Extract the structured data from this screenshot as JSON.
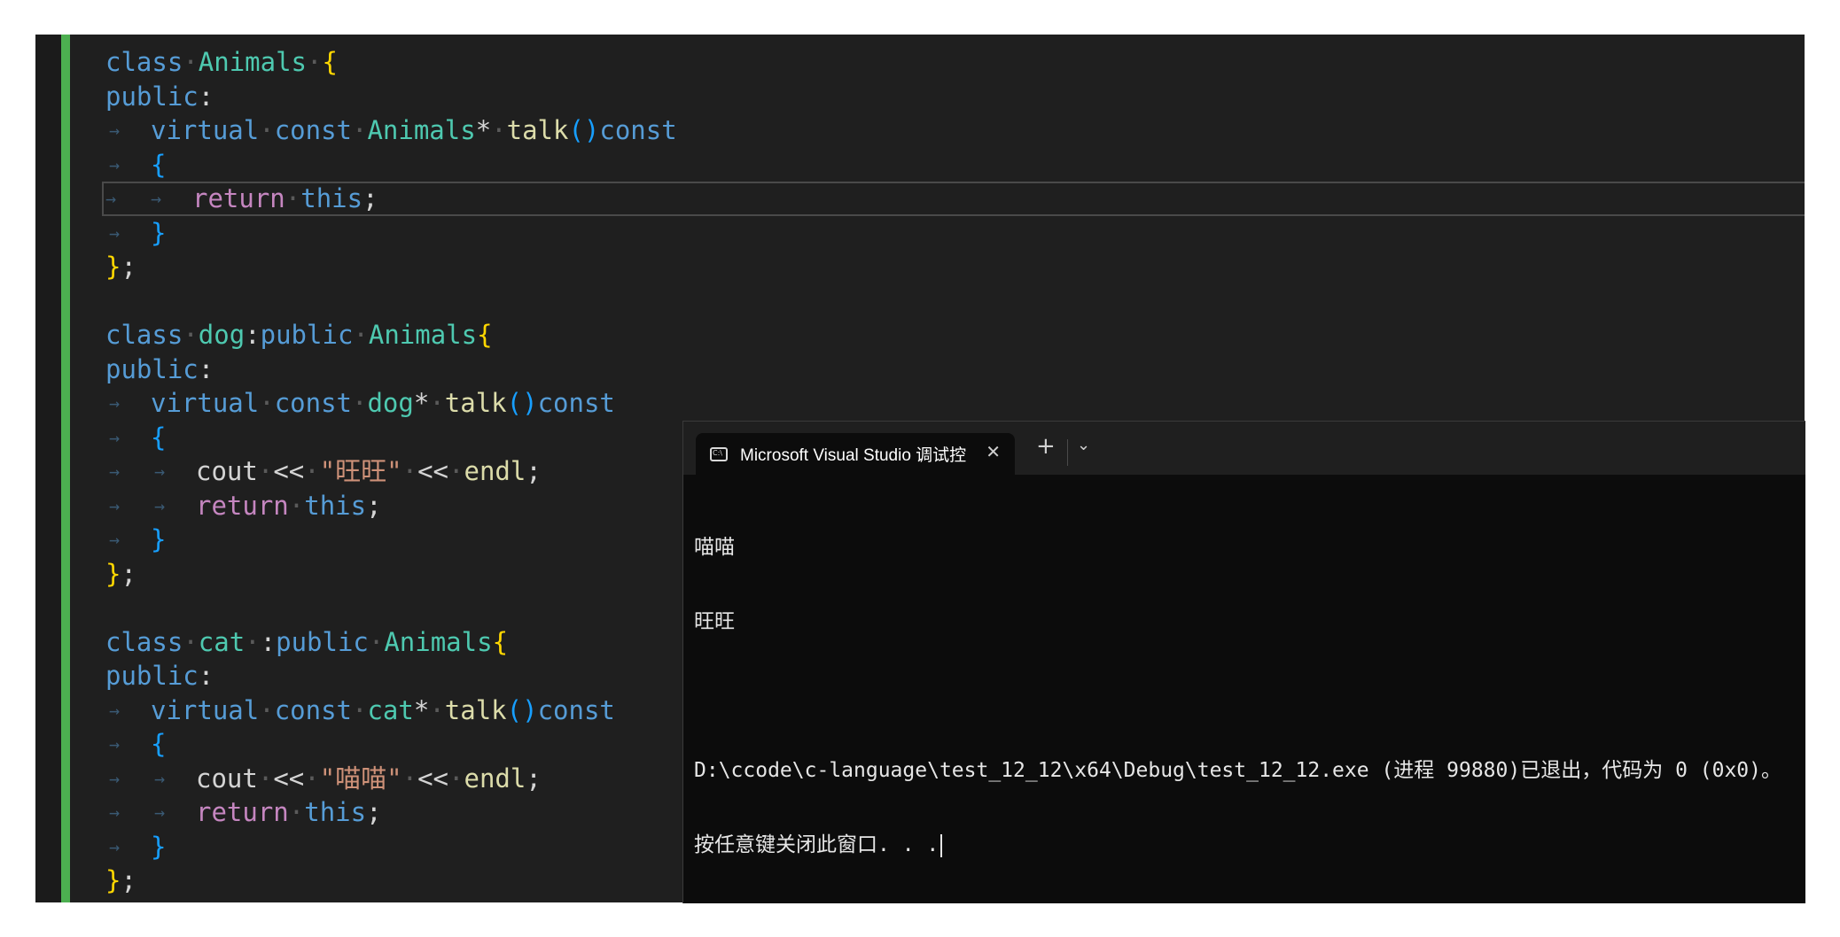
{
  "editor": {
    "lines": [
      {
        "indent": 0,
        "tokens": [
          {
            "t": "class",
            "c": "kw"
          },
          {
            "t": "·",
            "c": "dotsp"
          },
          {
            "t": "Animals",
            "c": "ty"
          },
          {
            "t": "·",
            "c": "dotsp"
          },
          {
            "t": "{",
            "c": "br1"
          }
        ]
      },
      {
        "indent": 0,
        "tokens": [
          {
            "t": "public",
            "c": "kw"
          },
          {
            "t": ":",
            "c": "op"
          }
        ]
      },
      {
        "indent": 1,
        "tokens": [
          {
            "t": "virtual",
            "c": "kw"
          },
          {
            "t": "·",
            "c": "dotsp"
          },
          {
            "t": "const",
            "c": "kw"
          },
          {
            "t": "·",
            "c": "dotsp"
          },
          {
            "t": "Animals",
            "c": "ty"
          },
          {
            "t": "*",
            "c": "op"
          },
          {
            "t": "·",
            "c": "dotsp"
          },
          {
            "t": "talk",
            "c": "fn"
          },
          {
            "t": "()",
            "c": "br2"
          },
          {
            "t": "const",
            "c": "kw"
          }
        ]
      },
      {
        "indent": 1,
        "tokens": [
          {
            "t": "{",
            "c": "br2"
          }
        ]
      },
      {
        "indent": 2,
        "current": true,
        "tokens": [
          {
            "t": "return",
            "c": "ctl"
          },
          {
            "t": "·",
            "c": "dotsp"
          },
          {
            "t": "this",
            "c": "kw"
          },
          {
            "t": ";",
            "c": "op"
          }
        ]
      },
      {
        "indent": 1,
        "tokens": [
          {
            "t": "}",
            "c": "br2"
          }
        ]
      },
      {
        "indent": 0,
        "tokens": [
          {
            "t": "}",
            "c": "br1"
          },
          {
            "t": ";",
            "c": "op"
          }
        ]
      },
      {
        "indent": 0,
        "tokens": []
      },
      {
        "indent": 0,
        "tokens": [
          {
            "t": "class",
            "c": "kw"
          },
          {
            "t": "·",
            "c": "dotsp"
          },
          {
            "t": "dog",
            "c": "ty"
          },
          {
            "t": ":",
            "c": "op"
          },
          {
            "t": "public",
            "c": "kw"
          },
          {
            "t": "·",
            "c": "dotsp"
          },
          {
            "t": "Animals",
            "c": "ty"
          },
          {
            "t": "{",
            "c": "br1"
          }
        ]
      },
      {
        "indent": 0,
        "tokens": [
          {
            "t": "public",
            "c": "kw"
          },
          {
            "t": ":",
            "c": "op"
          }
        ]
      },
      {
        "indent": 1,
        "tokens": [
          {
            "t": "virtual",
            "c": "kw"
          },
          {
            "t": "·",
            "c": "dotsp"
          },
          {
            "t": "const",
            "c": "kw"
          },
          {
            "t": "·",
            "c": "dotsp"
          },
          {
            "t": "dog",
            "c": "ty"
          },
          {
            "t": "*",
            "c": "op"
          },
          {
            "t": "·",
            "c": "dotsp"
          },
          {
            "t": "talk",
            "c": "fn"
          },
          {
            "t": "()",
            "c": "br2"
          },
          {
            "t": "const",
            "c": "kw"
          }
        ]
      },
      {
        "indent": 1,
        "tokens": [
          {
            "t": "{",
            "c": "br2"
          }
        ]
      },
      {
        "indent": 2,
        "tokens": [
          {
            "t": "cout",
            "c": "op"
          },
          {
            "t": "·",
            "c": "dotsp"
          },
          {
            "t": "<<",
            "c": "op"
          },
          {
            "t": "·",
            "c": "dotsp"
          },
          {
            "t": "\"旺旺\"",
            "c": "str"
          },
          {
            "t": "·",
            "c": "dotsp"
          },
          {
            "t": "<<",
            "c": "op"
          },
          {
            "t": "·",
            "c": "dotsp"
          },
          {
            "t": "endl",
            "c": "fn"
          },
          {
            "t": ";",
            "c": "op"
          }
        ]
      },
      {
        "indent": 2,
        "tokens": [
          {
            "t": "return",
            "c": "ctl"
          },
          {
            "t": "·",
            "c": "dotsp"
          },
          {
            "t": "this",
            "c": "kw"
          },
          {
            "t": ";",
            "c": "op"
          }
        ]
      },
      {
        "indent": 1,
        "tokens": [
          {
            "t": "}",
            "c": "br2"
          }
        ]
      },
      {
        "indent": 0,
        "tokens": [
          {
            "t": "}",
            "c": "br1"
          },
          {
            "t": ";",
            "c": "op"
          }
        ]
      },
      {
        "indent": 0,
        "tokens": []
      },
      {
        "indent": 0,
        "tokens": [
          {
            "t": "class",
            "c": "kw"
          },
          {
            "t": "·",
            "c": "dotsp"
          },
          {
            "t": "cat",
            "c": "ty"
          },
          {
            "t": "·",
            "c": "dotsp"
          },
          {
            "t": ":",
            "c": "op"
          },
          {
            "t": "public",
            "c": "kw"
          },
          {
            "t": "·",
            "c": "dotsp"
          },
          {
            "t": "Animals",
            "c": "ty"
          },
          {
            "t": "{",
            "c": "br1"
          }
        ]
      },
      {
        "indent": 0,
        "tokens": [
          {
            "t": "public",
            "c": "kw"
          },
          {
            "t": ":",
            "c": "op"
          }
        ]
      },
      {
        "indent": 1,
        "tokens": [
          {
            "t": "virtual",
            "c": "kw"
          },
          {
            "t": "·",
            "c": "dotsp"
          },
          {
            "t": "const",
            "c": "kw"
          },
          {
            "t": "·",
            "c": "dotsp"
          },
          {
            "t": "cat",
            "c": "ty"
          },
          {
            "t": "*",
            "c": "op"
          },
          {
            "t": "·",
            "c": "dotsp"
          },
          {
            "t": "talk",
            "c": "fn"
          },
          {
            "t": "()",
            "c": "br2"
          },
          {
            "t": "const",
            "c": "kw"
          }
        ]
      },
      {
        "indent": 1,
        "tokens": [
          {
            "t": "{",
            "c": "br2"
          }
        ]
      },
      {
        "indent": 2,
        "tokens": [
          {
            "t": "cout",
            "c": "op"
          },
          {
            "t": "·",
            "c": "dotsp"
          },
          {
            "t": "<<",
            "c": "op"
          },
          {
            "t": "·",
            "c": "dotsp"
          },
          {
            "t": "\"喵喵\"",
            "c": "str"
          },
          {
            "t": "·",
            "c": "dotsp"
          },
          {
            "t": "<<",
            "c": "op"
          },
          {
            "t": "·",
            "c": "dotsp"
          },
          {
            "t": "endl",
            "c": "fn"
          },
          {
            "t": ";",
            "c": "op"
          }
        ]
      },
      {
        "indent": 2,
        "tokens": [
          {
            "t": "return",
            "c": "ctl"
          },
          {
            "t": "·",
            "c": "dotsp"
          },
          {
            "t": "this",
            "c": "kw"
          },
          {
            "t": ";",
            "c": "op"
          }
        ]
      },
      {
        "indent": 1,
        "tokens": [
          {
            "t": "}",
            "c": "br2"
          }
        ]
      },
      {
        "indent": 0,
        "tokens": [
          {
            "t": "}",
            "c": "br1"
          },
          {
            "t": ";",
            "c": "op"
          }
        ]
      }
    ]
  },
  "terminal": {
    "tab_title": "Microsoft Visual Studio 调试控",
    "close_glyph": "✕",
    "new_tab_glyph": "+",
    "dropdown_glyph": "⌄",
    "output_line_1": "喵喵",
    "output_line_2": "旺旺",
    "exit_message": "D:\\ccode\\c-language\\test_12_12\\x64\\Debug\\test_12_12.exe (进程 99880)已退出，代码为 0 (0x0)。",
    "prompt_message": "按任意键关闭此窗口. . ."
  },
  "colors": {
    "editor_bg": "#1f1f1f",
    "change_bar": "#4caf50",
    "terminal_bg": "#0c0c0c",
    "keyword": "#569cd6",
    "type": "#4ec9b0",
    "function": "#dcdcaa",
    "control": "#c586c0",
    "string": "#ce9178"
  }
}
